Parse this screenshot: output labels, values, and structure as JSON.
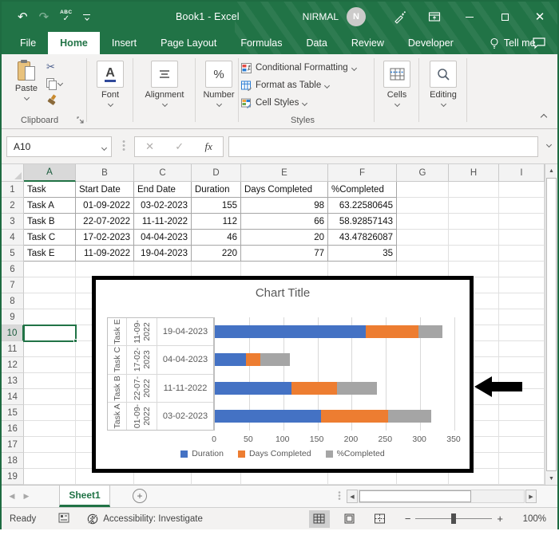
{
  "titlebar": {
    "title": "Book1 - Excel",
    "user": "NIRMAL",
    "avatar_initial": "N",
    "spelling_label": "ABC"
  },
  "menu": {
    "file": "File",
    "home": "Home",
    "insert": "Insert",
    "page_layout": "Page Layout",
    "formulas": "Formulas",
    "data": "Data",
    "review": "Review",
    "developer": "Developer",
    "tell_me": "Tell me"
  },
  "ribbon": {
    "paste": "Paste",
    "clipboard": "Clipboard",
    "font": "Font",
    "alignment": "Alignment",
    "number": "Number",
    "conditional_formatting": "Conditional Formatting",
    "format_as_table": "Format as Table",
    "cell_styles": "Cell Styles",
    "styles": "Styles",
    "cells": "Cells",
    "editing": "Editing",
    "number_icon_glyph": "%"
  },
  "formula_bar": {
    "name_box": "A10",
    "fx": "fx",
    "formula_value": ""
  },
  "grid": {
    "columns": [
      "A",
      "B",
      "C",
      "D",
      "E",
      "F",
      "G",
      "H",
      "I"
    ],
    "rows": [
      1,
      2,
      3,
      4,
      5,
      6,
      7,
      8,
      9,
      10,
      11,
      12,
      13,
      14,
      15,
      16,
      17,
      18,
      19
    ],
    "selected_cell": "A10",
    "selected_column": "A",
    "selected_row": 10,
    "table": {
      "headers": [
        "Task",
        "Start Date",
        "End Date",
        "Duration",
        "Days Completed",
        "%Completed"
      ],
      "rows": [
        [
          "Task A",
          "01-09-2022",
          "03-02-2023",
          "155",
          "98",
          "63.22580645"
        ],
        [
          "Task B",
          "22-07-2022",
          "11-11-2022",
          "112",
          "66",
          "58.92857143"
        ],
        [
          "Task C",
          "17-02-2023",
          "04-04-2023",
          "46",
          "20",
          "43.47826087"
        ],
        [
          "Task E",
          "11-09-2022",
          "19-04-2023",
          "220",
          "77",
          "35"
        ]
      ]
    }
  },
  "chart_data": {
    "type": "bar",
    "orientation": "horizontal",
    "stacked": true,
    "title": "Chart Title",
    "categories": [
      {
        "task": "Task A",
        "start": "01-09-2022",
        "end": "03-02-2023"
      },
      {
        "task": "Task B",
        "start": "22-07-2022",
        "end": "11-11-2022"
      },
      {
        "task": "Task C",
        "start": "17-02-2023",
        "end": "04-04-2023"
      },
      {
        "task": "Task E",
        "start": "11-09-2022",
        "end": "19-04-2023"
      }
    ],
    "series": [
      {
        "name": "Duration",
        "color": "#4472C4",
        "values": [
          155,
          112,
          46,
          220
        ]
      },
      {
        "name": "Days Completed",
        "color": "#ED7D31",
        "values": [
          98,
          66,
          20,
          77
        ]
      },
      {
        "name": "%Completed",
        "color": "#A5A5A5",
        "values": [
          63.22580645,
          58.92857143,
          43.47826087,
          35
        ]
      }
    ],
    "x_ticks": [
      0,
      50,
      100,
      150,
      200,
      250,
      300,
      350
    ],
    "xlim": [
      0,
      350
    ],
    "legend_position": "bottom",
    "display_order": "reversed",
    "grid": "vertical-gridlines-on"
  },
  "sheet_bar": {
    "tab": "Sheet1"
  },
  "status_bar": {
    "ready": "Ready",
    "accessibility": "Accessibility: Investigate",
    "zoom_level": "100%"
  },
  "colors": {
    "accent_green": "#217346",
    "bar_blue": "#4472C4",
    "bar_orange": "#ED7D31",
    "bar_gray": "#A5A5A5",
    "chart_text": "#595959"
  }
}
